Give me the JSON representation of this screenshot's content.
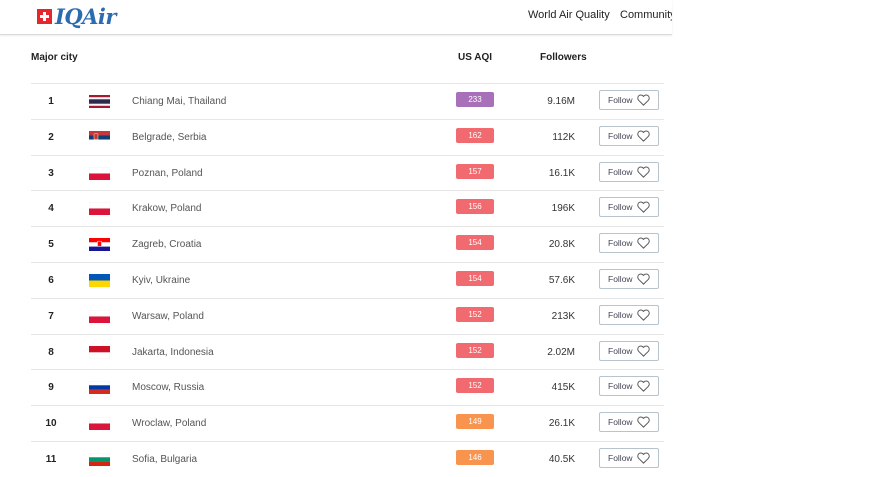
{
  "brand": {
    "name": "IQAir"
  },
  "nav": [
    {
      "label": "World Air Quality"
    },
    {
      "label": "Community"
    }
  ],
  "table": {
    "headers": {
      "city": "Major city",
      "aqi": "US AQI",
      "followers": "Followers"
    },
    "follow_label": "Follow",
    "rows": [
      {
        "rank": "1",
        "city": "Chiang Mai, Thailand",
        "aqi": "233",
        "aqi_color": "#a770b8",
        "followers": "9.16M",
        "flag": "th"
      },
      {
        "rank": "2",
        "city": "Belgrade, Serbia",
        "aqi": "162",
        "aqi_color": "#f16a6f",
        "followers": "112K",
        "flag": "rs"
      },
      {
        "rank": "3",
        "city": "Poznan, Poland",
        "aqi": "157",
        "aqi_color": "#f16a6f",
        "followers": "16.1K",
        "flag": "pl"
      },
      {
        "rank": "4",
        "city": "Krakow, Poland",
        "aqi": "156",
        "aqi_color": "#f16a6f",
        "followers": "196K",
        "flag": "pl"
      },
      {
        "rank": "5",
        "city": "Zagreb, Croatia",
        "aqi": "154",
        "aqi_color": "#f16a6f",
        "followers": "20.8K",
        "flag": "hr"
      },
      {
        "rank": "6",
        "city": "Kyiv, Ukraine",
        "aqi": "154",
        "aqi_color": "#f16a6f",
        "followers": "57.6K",
        "flag": "ua"
      },
      {
        "rank": "7",
        "city": "Warsaw, Poland",
        "aqi": "152",
        "aqi_color": "#f16a6f",
        "followers": "213K",
        "flag": "pl"
      },
      {
        "rank": "8",
        "city": "Jakarta, Indonesia",
        "aqi": "152",
        "aqi_color": "#f16a6f",
        "followers": "2.02M",
        "flag": "id"
      },
      {
        "rank": "9",
        "city": "Moscow, Russia",
        "aqi": "152",
        "aqi_color": "#f16a6f",
        "followers": "415K",
        "flag": "ru"
      },
      {
        "rank": "10",
        "city": "Wroclaw, Poland",
        "aqi": "149",
        "aqi_color": "#f8944e",
        "followers": "26.1K",
        "flag": "pl"
      },
      {
        "rank": "11",
        "city": "Sofia, Bulgaria",
        "aqi": "146",
        "aqi_color": "#f8944e",
        "followers": "40.5K",
        "flag": "bg"
      }
    ]
  }
}
